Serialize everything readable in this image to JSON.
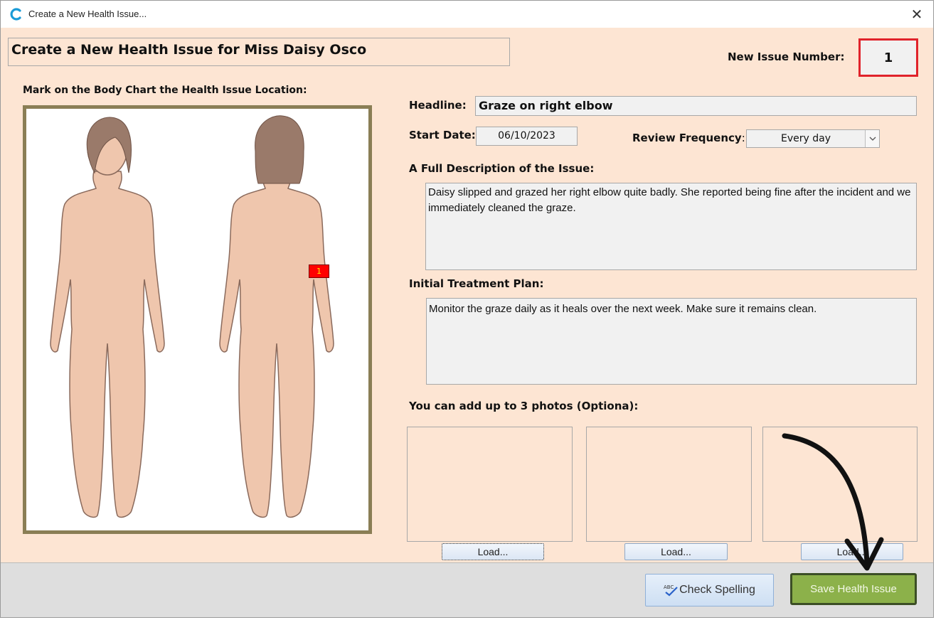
{
  "window": {
    "title": "Create a New Health Issue...",
    "close_glyph": "✕",
    "app_icon": "c-logo-icon"
  },
  "header": {
    "title": "Create a New Health Issue for Miss Daisy Osco",
    "issue_number_label": "New Issue Number:",
    "issue_number": "1"
  },
  "body_chart": {
    "label": "Mark on the Body Chart the Health Issue Location:",
    "marker_label": "1"
  },
  "form": {
    "headline_label": "Headline:",
    "headline_value": "Graze on right elbow",
    "start_date_label": "Start Date:",
    "start_date_value": "06/10/2023",
    "review_label": "Review Frequency",
    "review_colon": ":",
    "review_value": "Every day",
    "description_label": "A Full Description of the Issue:",
    "description_value": "Daisy slipped and grazed her right elbow quite badly. She reported being fine after the incident and we immediately cleaned the graze.",
    "plan_label": "Initial Treatment Plan:",
    "plan_value": "Monitor the graze daily as it heals over the next week. Make sure it remains clean.",
    "photos_label": "You can add up to 3 photos (Optiona):"
  },
  "photos": [
    {
      "load_label": "Load..."
    },
    {
      "load_label": "Load..."
    },
    {
      "load_label": "Load..."
    }
  ],
  "footer": {
    "spell_label": "Check Spelling",
    "save_label": "Save Health Issue"
  },
  "colors": {
    "background": "#fde5d3",
    "issue_box_border": "#e0232b",
    "save_button": "#8cb14a",
    "marker": "#ff0000"
  }
}
